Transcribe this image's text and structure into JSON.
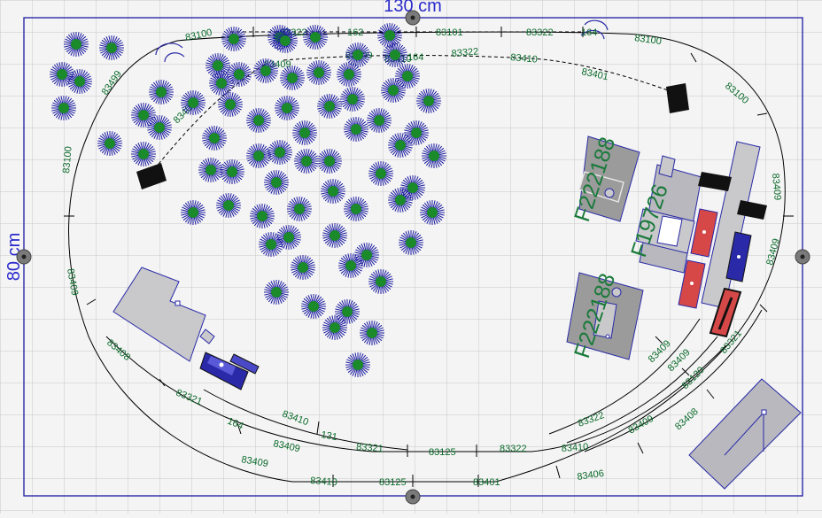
{
  "dimensions": {
    "width_label": "130 cm",
    "height_label": "80 cm"
  },
  "colors": {
    "grid": "#c9c9c9",
    "board_border": "#2a2aa8",
    "dimension_text": "#2a2acc",
    "track": "#000000",
    "track_label": "#0a6a2a",
    "tree_outline": "#1a1aa0",
    "tree_fill": "#1a8a2a",
    "building": "#9b9b9b",
    "building_light": "#c9c9cc",
    "building_outline": "#2a2acc",
    "building_label": "#1a7a3a",
    "wagon_red": "#d64848",
    "loco_blue": "#2a2aa8",
    "handle": "#7a7a7a"
  },
  "track_labels": [
    "83100",
    "83322",
    "162",
    "83101",
    "83322",
    "164",
    "83100",
    "83409",
    "83409",
    "83410",
    "164",
    "83322",
    "83410",
    "83401",
    "83499",
    "83409",
    "83100",
    "83100",
    "83409",
    "83409",
    "83409",
    "83408",
    "83321",
    "164",
    "83410",
    "131",
    "83409",
    "83321",
    "83125",
    "83322",
    "83410",
    "83322",
    "83409",
    "83409",
    "83409",
    "83120",
    "83408",
    "83321",
    "83409",
    "83410",
    "83125",
    "83401",
    "83406"
  ],
  "building_labels": [
    "F222188",
    "F19726",
    "F222188"
  ],
  "icons": {
    "tree": "tree-icon",
    "building": "building-icon",
    "locomotive": "locomotive-icon",
    "wagon": "wagon-icon",
    "bumper": "buffer-stop-icon",
    "resize_handle": "resize-handle-icon"
  }
}
